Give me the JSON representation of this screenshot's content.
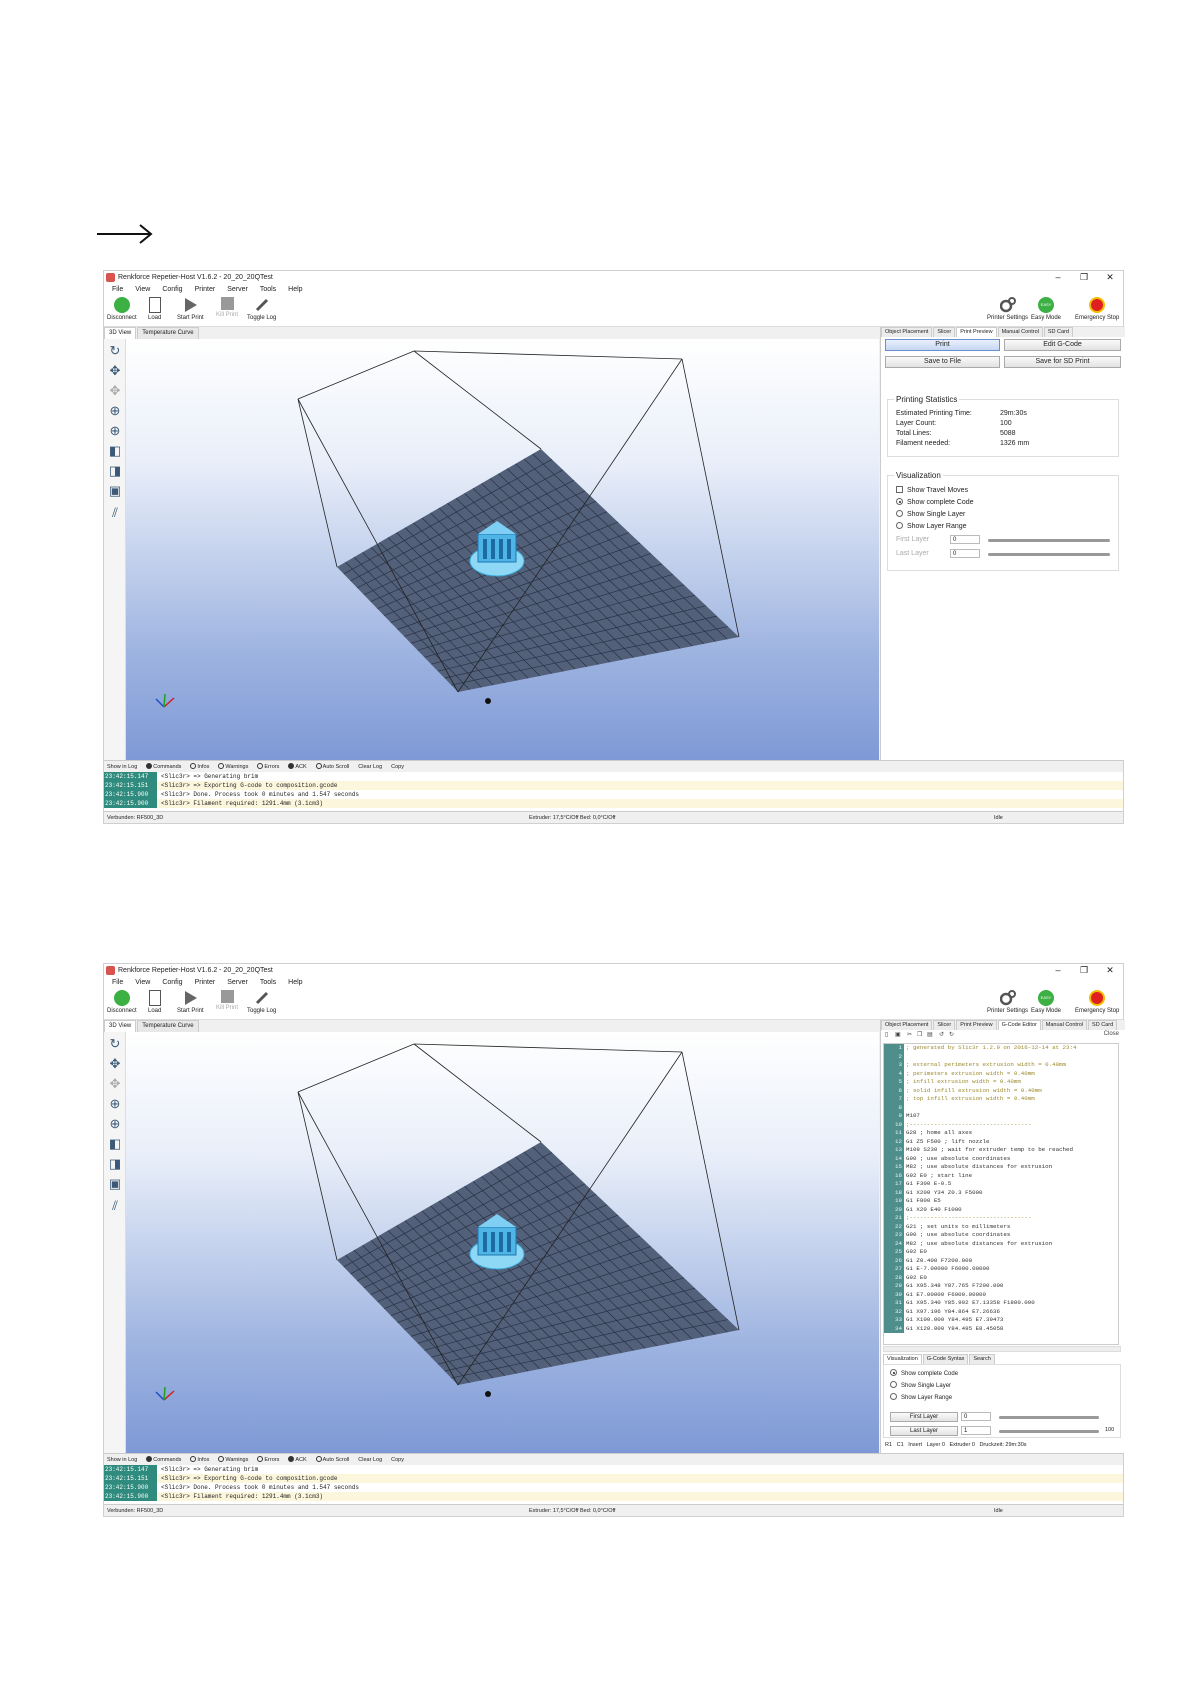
{
  "app_title": "Renkforce Repetier-Host V1.6.2 - 20_20_20QTest",
  "window_controls": [
    "–",
    "❐",
    "✕"
  ],
  "menu": [
    "File",
    "View",
    "Config",
    "Printer",
    "Server",
    "Tools",
    "Help"
  ],
  "toolbar": {
    "disconnect": "Disconnect",
    "load": "Load",
    "start_print": "Start Print",
    "kill_print": "Kill Print",
    "toggle_log": "Toggle Log",
    "printer_settings": "Printer Settings",
    "easy_mode": "Easy Mode",
    "easy_badge": "EASY",
    "emergency_stop": "Emergency Stop"
  },
  "view_tabs": [
    "3D View",
    "Temperature Curve"
  ],
  "right_tabs_1": [
    "Object Placement",
    "Slicer",
    "Print Preview",
    "Manual Control",
    "SD Card"
  ],
  "right_tabs_2": [
    "Object Placement",
    "Slicer",
    "Print Preview",
    "G-Code Editor",
    "Manual Control",
    "SD Card"
  ],
  "preview": {
    "print": "Print",
    "edit_gcode": "Edit G-Code",
    "save_to_file": "Save to File",
    "save_sd": "Save for SD Print",
    "stats_title": "Printing Statistics",
    "stats": [
      {
        "label": "Estimated Printing Time:",
        "value": "29m:30s"
      },
      {
        "label": "Layer Count:",
        "value": "100"
      },
      {
        "label": "Total Lines:",
        "value": "5088"
      },
      {
        "label": "Filament needed:",
        "value": "1326 mm"
      }
    ],
    "vis_title": "Visualization",
    "show_travel": "Show Travel Moves",
    "show_complete": "Show complete Code",
    "show_single": "Show Single Layer",
    "show_range": "Show Layer Range",
    "first_layer": "First Layer",
    "last_layer": "Last Layer",
    "first_val": "0",
    "last_val": "0"
  },
  "editor": {
    "close": "Close",
    "lines": [
      {
        "n": "1",
        "text": "; generated by Slic3r 1.2.9 on 2016-12-14 at 23:4",
        "c": "cm"
      },
      {
        "n": "2",
        "text": "",
        "c": "cc"
      },
      {
        "n": "3",
        "text": "; external perimeters extrusion width = 0.40mm",
        "c": "cm"
      },
      {
        "n": "4",
        "text": "; perimeters extrusion width = 0.40mm",
        "c": "cm"
      },
      {
        "n": "5",
        "text": "; infill extrusion width = 0.40mm",
        "c": "cm"
      },
      {
        "n": "6",
        "text": "; solid infill extrusion width = 0.40mm",
        "c": "cm"
      },
      {
        "n": "7",
        "text": "; top infill extrusion width = 0.40mm",
        "c": "cm"
      },
      {
        "n": "8",
        "text": "",
        "c": "cc"
      },
      {
        "n": "9",
        "text": "M107",
        "c": "cc"
      },
      {
        "n": "10",
        "text": ";-----------------------------------",
        "c": "cm"
      },
      {
        "n": "11",
        "text": "G28 ; home all axes",
        "c": "cc"
      },
      {
        "n": "12",
        "text": "G1 Z5 F500 ; lift nozzle",
        "c": "cc"
      },
      {
        "n": "13",
        "text": "M109 S230 ; wait for extruder temp to be reached",
        "c": "cc"
      },
      {
        "n": "14",
        "text": "G90 ; use absolute coordinates",
        "c": "cc"
      },
      {
        "n": "15",
        "text": "M82 ; use absolute distances for extrusion",
        "c": "cc"
      },
      {
        "n": "16",
        "text": "G92 E0 ; start line",
        "c": "cc"
      },
      {
        "n": "17",
        "text": "G1 F300 E-0.5",
        "c": "cc"
      },
      {
        "n": "18",
        "text": "G1 X200 Y34 Z0.3 F5000",
        "c": "cc"
      },
      {
        "n": "19",
        "text": "G1 F800 E5",
        "c": "cc"
      },
      {
        "n": "20",
        "text": "G1 X20 E40 F1000",
        "c": "cc"
      },
      {
        "n": "21",
        "text": ";-----------------------------------",
        "c": "cm"
      },
      {
        "n": "22",
        "text": "G21 ; set units to millimeters",
        "c": "cc"
      },
      {
        "n": "23",
        "text": "G90 ; use absolute coordinates",
        "c": "cc"
      },
      {
        "n": "24",
        "text": "M82 ; use absolute distances for extrusion",
        "c": "cc"
      },
      {
        "n": "25",
        "text": "G92 E0",
        "c": "cc"
      },
      {
        "n": "26",
        "text": "G1 Z0.400 F7200.000",
        "c": "cc"
      },
      {
        "n": "27",
        "text": "G1 E-7.00000 F6000.00000",
        "c": "cc"
      },
      {
        "n": "28",
        "text": "G92 E0",
        "c": "cc"
      },
      {
        "n": "29",
        "text": "G1 X95.348 Y87.765 F7200.000",
        "c": "cc"
      },
      {
        "n": "30",
        "text": "G1 E7.00000 F6000.00000",
        "c": "cc"
      },
      {
        "n": "31",
        "text": "G1 X95.340 Y85.992 E7.13358 F1800.000",
        "c": "cc"
      },
      {
        "n": "32",
        "text": "G1 X97.196 Y84.864 E7.26636",
        "c": "cc"
      },
      {
        "n": "33",
        "text": "G1 X100.000 Y84.495 E7.39473",
        "c": "cc"
      },
      {
        "n": "34",
        "text": "G1 X120.000 Y84.495 E8.45058",
        "c": "cc"
      }
    ],
    "vis_tabs": [
      "Visualization",
      "G-Code Syntax",
      "Search"
    ],
    "show_complete": "Show complete Code",
    "show_single": "Show Single Layer",
    "show_range": "Show Layer Range",
    "first_layer": "First Layer",
    "last_layer": "Last Layer",
    "first_val": "0",
    "last_val": "1",
    "range_max": "100",
    "status": "R1   C1   Insert   Layer 0   Extruder 0   Druckzeit: 29m:30s"
  },
  "logbar": {
    "show_in_log": "Show in Log",
    "commands": "Commands",
    "infos": "Infos",
    "warnings": "Warnings",
    "errors": "Errors",
    "ack": "ACK",
    "auto_scroll": "Auto Scroll",
    "clear_log": "Clear Log",
    "copy": "Copy"
  },
  "log": [
    {
      "time": "23:42:15.147",
      "msg": "<Slic3r> => Generating brim"
    },
    {
      "time": "23:42:15.151",
      "msg": "<Slic3r> => Exporting G-code to composition.gcode"
    },
    {
      "time": "23:42:15.900",
      "msg": "<Slic3r> Done. Process took 0 minutes and 1.547 seconds"
    },
    {
      "time": "23:42:15.900",
      "msg": "<Slic3r> Filament required: 1291.4mm (3.1cm3)"
    }
  ],
  "status": {
    "connection": "Verbunden: RF500_3D",
    "temps": "Extruder: 17,5°C/Off Bed: 0,0°C/Off",
    "state": "Idle"
  },
  "colors": {
    "accent": "#6a8fd0",
    "log_time_bg": "#2e8b7d",
    "viewport_bottom": "#7e99d6"
  }
}
